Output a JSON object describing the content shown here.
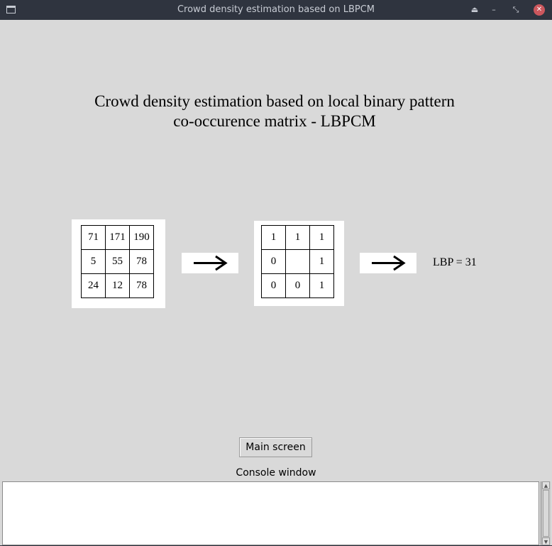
{
  "window": {
    "title": "Crowd density estimation based on LBPCM",
    "buttons": {
      "shade": "⏏",
      "minimize": "–",
      "maximize": "⤡",
      "close": "✕"
    }
  },
  "heading": {
    "line1": "Crowd density estimation based on local binary pattern",
    "line2": "co-occurence matrix - LBPCM"
  },
  "input_grid": {
    "rows": [
      [
        "71",
        "171",
        "190"
      ],
      [
        "5",
        "55",
        "78"
      ],
      [
        "24",
        "12",
        "78"
      ]
    ]
  },
  "binary_grid": {
    "rows": [
      [
        "1",
        "1",
        "1"
      ],
      [
        "0",
        "",
        "1"
      ],
      [
        "0",
        "0",
        "1"
      ]
    ]
  },
  "arrows": [
    "right-arrow-icon",
    "right-arrow-icon"
  ],
  "result": {
    "label": "LBP = 31"
  },
  "controls": {
    "main_screen_label": "Main screen"
  },
  "console": {
    "label": "Console window",
    "content": ""
  },
  "colors": {
    "titlebar_bg": "#2f343f",
    "window_bg": "#d9d9d9",
    "close_button": "#cc575d",
    "panel_bg": "#ffffff"
  }
}
